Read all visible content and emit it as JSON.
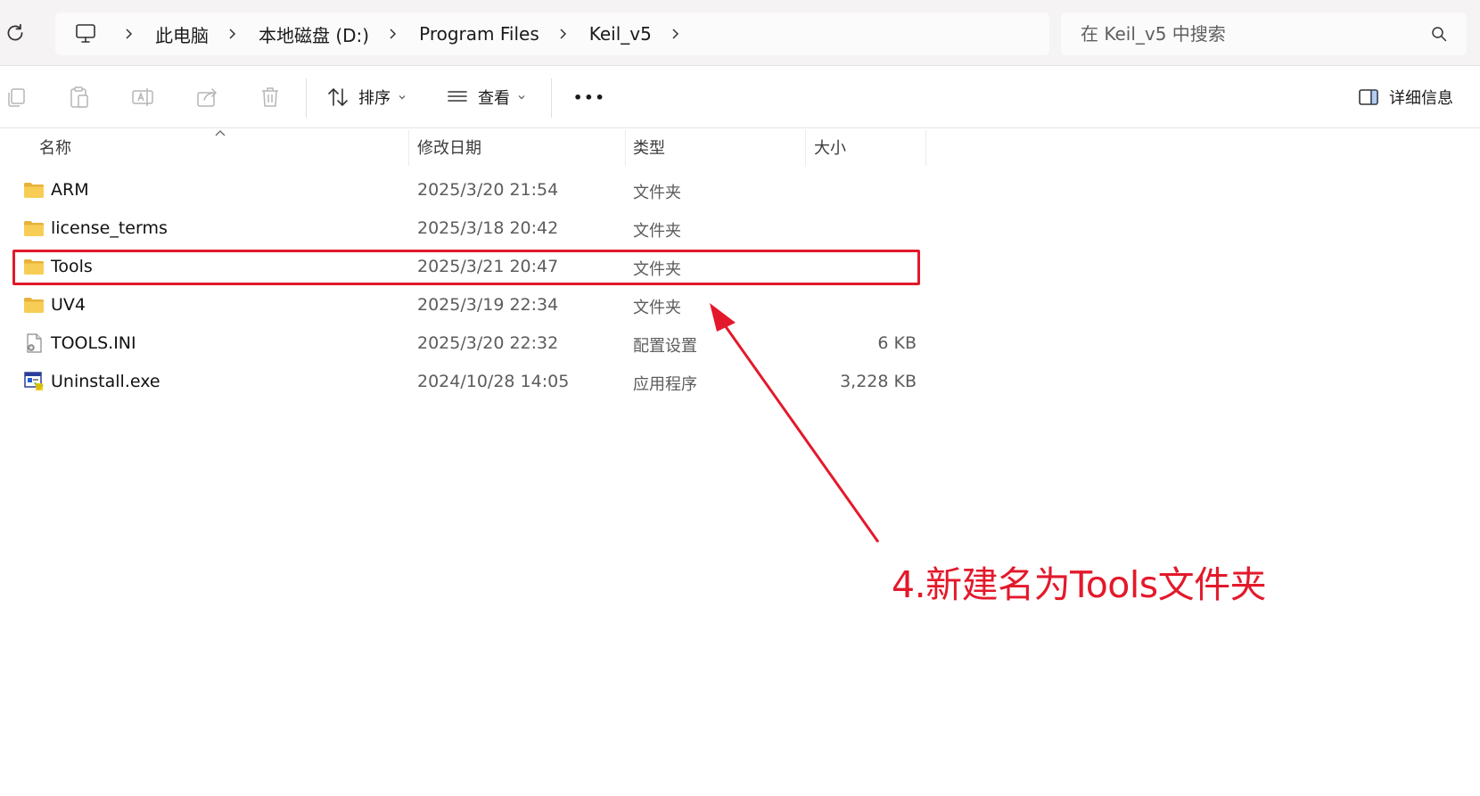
{
  "breadcrumb": {
    "items": [
      "此电脑",
      "本地磁盘 (D:)",
      "Program Files",
      "Keil_v5"
    ]
  },
  "search": {
    "placeholder": "在 Keil_v5 中搜索"
  },
  "toolbar": {
    "sort_label": "排序",
    "view_label": "查看",
    "more_label": "•••",
    "details_label": "详细信息"
  },
  "columns": {
    "name": "名称",
    "date": "修改日期",
    "type": "类型",
    "size": "大小"
  },
  "files": [
    {
      "name": "ARM",
      "date": "2025/3/20 21:54",
      "type": "文件夹",
      "size": "",
      "icon": "folder-icon"
    },
    {
      "name": "license_terms",
      "date": "2025/3/18 20:42",
      "type": "文件夹",
      "size": "",
      "icon": "folder-icon"
    },
    {
      "name": "Tools",
      "date": "2025/3/21 20:47",
      "type": "文件夹",
      "size": "",
      "icon": "folder-icon"
    },
    {
      "name": "UV4",
      "date": "2025/3/19 22:34",
      "type": "文件夹",
      "size": "",
      "icon": "folder-icon"
    },
    {
      "name": "TOOLS.INI",
      "date": "2025/3/20 22:32",
      "type": "配置设置",
      "size": "6 KB",
      "icon": "ini-file-icon"
    },
    {
      "name": "Uninstall.exe",
      "date": "2024/10/28 14:05",
      "type": "应用程序",
      "size": "3,228 KB",
      "icon": "exe-file-icon"
    }
  ],
  "annotation": {
    "text": "4.新建名为Tools文件夹",
    "color": "#e3192b"
  }
}
